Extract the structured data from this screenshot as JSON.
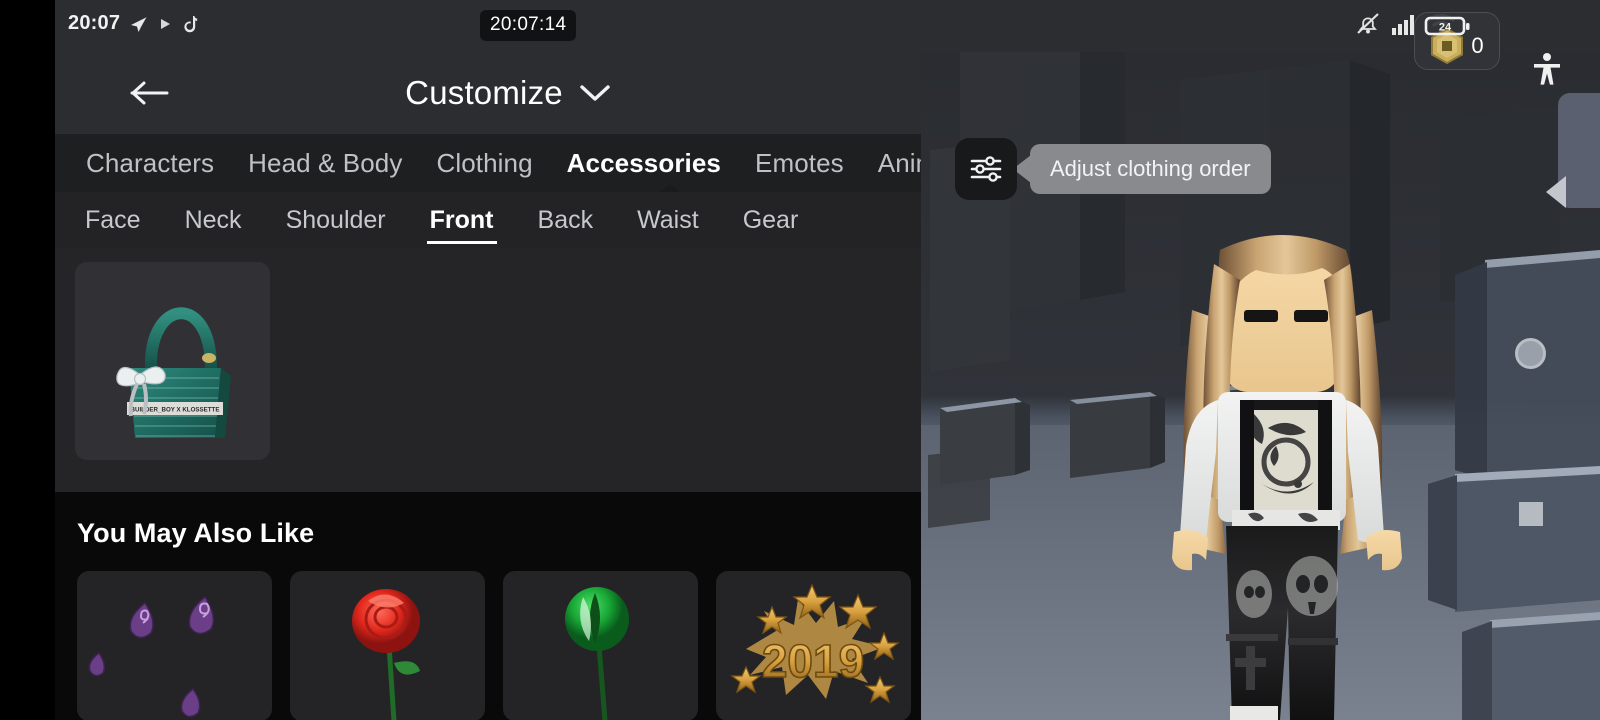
{
  "status_bar": {
    "time": "20:07",
    "icons_left": [
      "telegram-icon",
      "play-icon",
      "tiktok-note-icon"
    ],
    "clock_overlay": "20:07:14",
    "icons_right": [
      "mute-bell-icon",
      "signal-bars-icon",
      "wifi-icon"
    ],
    "battery_level": "24",
    "robux_count": "0",
    "accessibility_icon": "accessibility-person-icon"
  },
  "panel": {
    "back_icon": "back-arrow-icon",
    "title": "Customize",
    "title_chevron": "chevron-down-icon",
    "tabs": [
      {
        "label": "Characters",
        "active": false
      },
      {
        "label": "Head & Body",
        "active": false
      },
      {
        "label": "Clothing",
        "active": false
      },
      {
        "label": "Accessories",
        "active": true
      },
      {
        "label": "Emotes",
        "active": false
      },
      {
        "label": "Animat",
        "active": false
      }
    ],
    "subtabs": [
      {
        "label": "Face",
        "active": false
      },
      {
        "label": "Neck",
        "active": false
      },
      {
        "label": "Shoulder",
        "active": false
      },
      {
        "label": "Front",
        "active": true
      },
      {
        "label": "Back",
        "active": false
      },
      {
        "label": "Waist",
        "active": false
      },
      {
        "label": "Gear",
        "active": false
      }
    ],
    "items": [
      {
        "name": "teal-handbag",
        "label": "BUILDER_BOY X KLOSSETTE"
      }
    ],
    "recommendations": {
      "title": "You May Also Like",
      "items": [
        {
          "name": "purple-flame-particles"
        },
        {
          "name": "red-rose"
        },
        {
          "name": "green-rose"
        },
        {
          "name": "2019-gold-starburst",
          "label": "2019"
        }
      ]
    }
  },
  "overlay": {
    "adjust_button_icon": "sliders-icon",
    "tooltip_text": "Adjust clothing order"
  },
  "viewport_controls": {
    "collapse_handle_icon": "triangle-left-icon",
    "rotate_icon": "circle-icon",
    "stop_icon": "square-icon"
  },
  "colors": {
    "panel_bg": "#27272a",
    "header_bg": "#2b2d30",
    "tabs_bg": "#1e1f21",
    "reco_bg": "#09090a",
    "accent_white": "#ffffff",
    "tooltip_bg": "#888a8d",
    "robux_gold": "#c8ad5a",
    "bag_teal": "#2a7d74",
    "ground": "#6a7280"
  }
}
